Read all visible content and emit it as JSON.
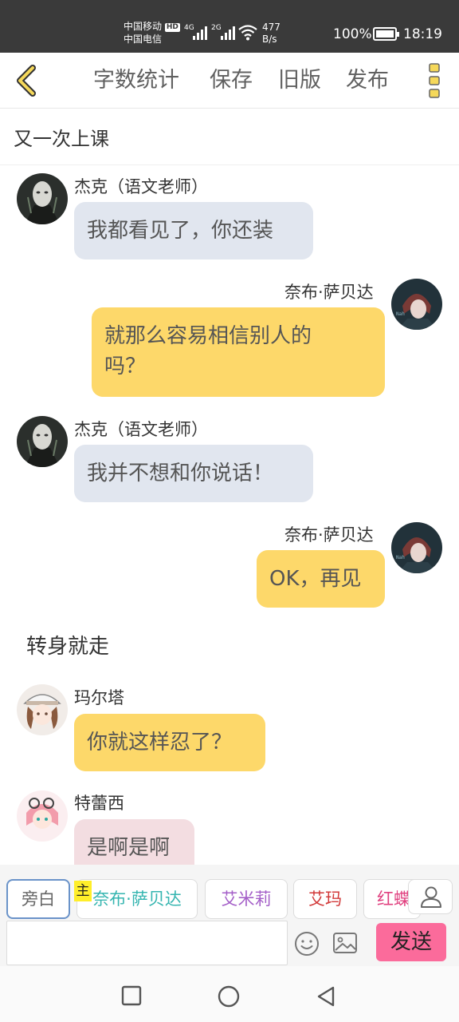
{
  "status_bar": {
    "carrier1": "中国移动",
    "carrier1_badge": "HD",
    "carrier2": "中国电信",
    "sig1": "4G",
    "sig2": "2G",
    "speed_value": "477",
    "speed_unit": "B/s",
    "battery": "100%",
    "time": "18:19"
  },
  "toolbar": {
    "word_count": "字数统计",
    "save": "保存",
    "old_version": "旧版",
    "publish": "发布"
  },
  "title": "又一次上课",
  "messages": [
    {
      "speaker": "杰克（语文老师）",
      "text": "我都看见了，你还装",
      "side": "left",
      "bubble_color": "#e1e6ef"
    },
    {
      "speaker": "奈布·萨贝达",
      "text_line1": "就那么容易相信别人的",
      "text_line2": "吗？",
      "side": "right",
      "bubble_color": "#fdd86a"
    },
    {
      "speaker": "杰克（语文老师）",
      "text": "我并不想和你说话！",
      "side": "left",
      "bubble_color": "#e1e6ef"
    },
    {
      "speaker": "奈布·萨贝达",
      "text": "OK，再见",
      "side": "right",
      "bubble_color": "#fdd86a"
    },
    {
      "speaker": "玛尔塔",
      "text": "你就这样忍了？",
      "side": "left",
      "bubble_color": "#fdd86a"
    },
    {
      "speaker": "特蕾西",
      "text": "是啊是啊",
      "side": "left",
      "bubble_color": "#f3dde1"
    }
  ],
  "narration": "转身就走",
  "characters": [
    {
      "label": "旁白",
      "color": "#666666"
    },
    {
      "label": "奈布·萨贝达",
      "color": "#35b5b0"
    },
    {
      "label": "艾米莉",
      "color": "#a45fc8"
    },
    {
      "label": "艾玛",
      "color": "#d23a3a"
    },
    {
      "label": "红蝶",
      "color": "#e0407f"
    }
  ],
  "main_tag": "主",
  "input": {
    "value": "",
    "placeholder": ""
  },
  "send_label": "发送",
  "icons": [
    "back-icon",
    "more-icon",
    "person-icon",
    "emoji-icon",
    "image-icon",
    "square-nav-icon",
    "circle-nav-icon",
    "triangle-back-nav-icon"
  ]
}
